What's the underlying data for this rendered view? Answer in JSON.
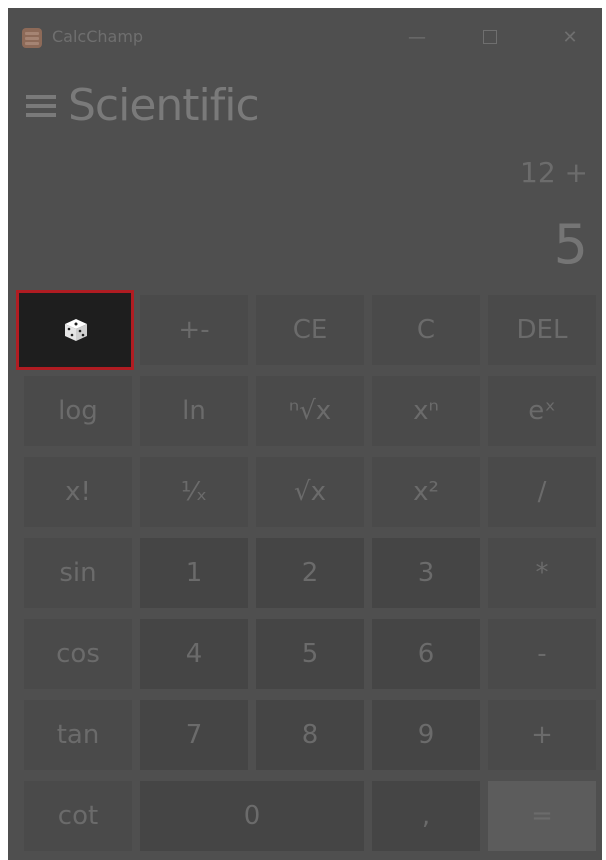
{
  "app": {
    "title": "CalcChamp",
    "mode": "Scientific"
  },
  "window_controls": {
    "minimize": "—",
    "close": "✕"
  },
  "display": {
    "expression": "12 +",
    "result": "5"
  },
  "buttons": {
    "random": "dice-icon",
    "plus_minus": "+-",
    "ce": "CE",
    "c": "C",
    "del": "DEL",
    "log": "log",
    "ln": "ln",
    "nth_root": "ⁿ√x",
    "x_pow_n": "xⁿ",
    "e_pow_x": "eˣ",
    "factorial": "x!",
    "reciprocal": "¹⁄ₓ",
    "sqrt": "√x",
    "square": "x²",
    "divide": "/",
    "sin": "sin",
    "one": "1",
    "two": "2",
    "three": "3",
    "multiply": "*",
    "cos": "cos",
    "four": "4",
    "five": "5",
    "six": "6",
    "minus": "-",
    "tan": "tan",
    "seven": "7",
    "eight": "8",
    "nine": "9",
    "plus": "+",
    "cot": "cot",
    "zero": "0",
    "comma": ",",
    "equals": "="
  },
  "colors": {
    "window_bg": "#4f4f4f",
    "button_bg": "#4a4a4a",
    "selected_button_bg": "#1e1e1e",
    "selected_outline": "#b01c22",
    "equals_bg": "#5c5c5c"
  }
}
